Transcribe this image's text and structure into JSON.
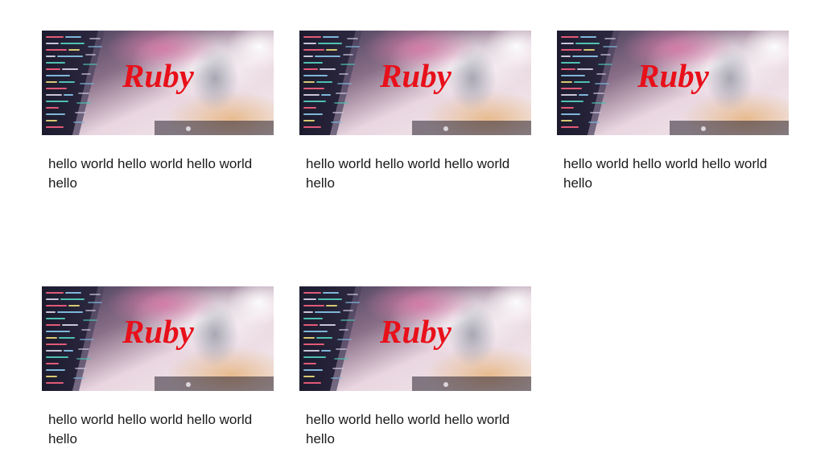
{
  "cards": [
    {
      "image_text": "Ruby",
      "caption": "hello world hello world hello world hello"
    },
    {
      "image_text": "Ruby",
      "caption": "hello world hello world hello world hello"
    },
    {
      "image_text": "Ruby",
      "caption": "hello world hello world hello world hello"
    },
    {
      "image_text": "Ruby",
      "caption": "hello world hello world hello world hello"
    },
    {
      "image_text": "Ruby",
      "caption": "hello world hello world hello world hello"
    }
  ],
  "colors": {
    "label_red": "#e8101a",
    "caption_text": "#1a1a1a",
    "background": "#ffffff"
  }
}
